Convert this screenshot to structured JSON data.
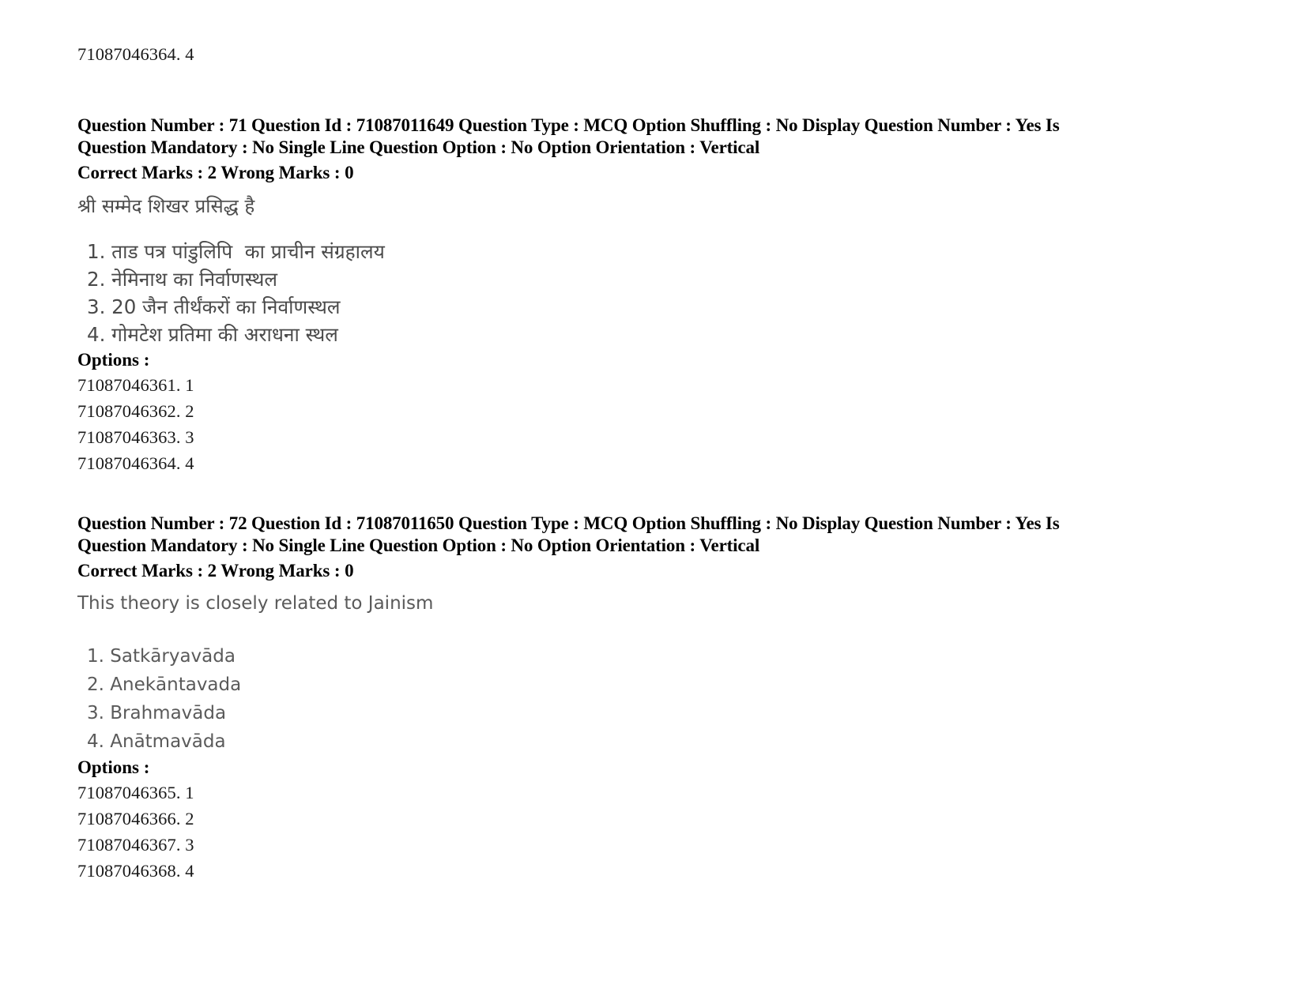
{
  "page": {
    "background_color": "#ffffff",
    "text_color_meta": "#000000",
    "text_color_body": "#5a5a5a"
  },
  "orphan_option": {
    "id": "71087046364.",
    "number": "4",
    "full": "71087046364. 4"
  },
  "questions": [
    {
      "meta_line1": "Question Number : 71 Question Id : 71087011649 Question Type : MCQ Option Shuffling : No Display Question Number : Yes Is",
      "meta_line2": "Question Mandatory : No Single Line Question Option : No Option Orientation : Vertical",
      "marks_line": "Correct Marks : 2 Wrong Marks : 0",
      "question_number": "71",
      "question_id": "71087011649",
      "question_type": "MCQ",
      "option_shuffling": "No",
      "display_question_number": "Yes",
      "is_question_mandatory": "No",
      "single_line_question_option": "No",
      "option_orientation": "Vertical",
      "correct_marks": "2",
      "wrong_marks": "0",
      "language": "hi",
      "stem": "श्री सम्मेद शिखर प्रसिद्ध है",
      "choices": [
        "1. ताड पत्र पांडुलिपि  का प्राचीन संग्रहालय",
        "2. नेमिनाथ का निर्वाणस्थल",
        "3. 20 जैन तीर्थंकरों का निर्वाणस्थल",
        "4. गोमटेश प्रतिमा की अराधना स्थल"
      ],
      "options_label": "Options :",
      "option_ids": [
        "71087046361. 1",
        "71087046362. 2",
        "71087046363. 3",
        "71087046364. 4"
      ]
    },
    {
      "meta_line1": "Question Number : 72 Question Id : 71087011650 Question Type : MCQ Option Shuffling : No Display Question Number : Yes Is",
      "meta_line2": "Question Mandatory : No Single Line Question Option : No Option Orientation : Vertical",
      "marks_line": "Correct Marks : 2 Wrong Marks : 0",
      "question_number": "72",
      "question_id": "71087011650",
      "question_type": "MCQ",
      "option_shuffling": "No",
      "display_question_number": "Yes",
      "is_question_mandatory": "No",
      "single_line_question_option": "No",
      "option_orientation": "Vertical",
      "correct_marks": "2",
      "wrong_marks": "0",
      "language": "en",
      "stem": "This theory is closely related to Jainism",
      "choices": [
        "1. Satkāryavāda",
        "2. Anekāntavada",
        "3. Brahmavāda",
        "4. Anātmavāda"
      ],
      "options_label": "Options :",
      "option_ids": [
        "71087046365. 1",
        "71087046366. 2",
        "71087046367. 3",
        "71087046368. 4"
      ]
    }
  ]
}
